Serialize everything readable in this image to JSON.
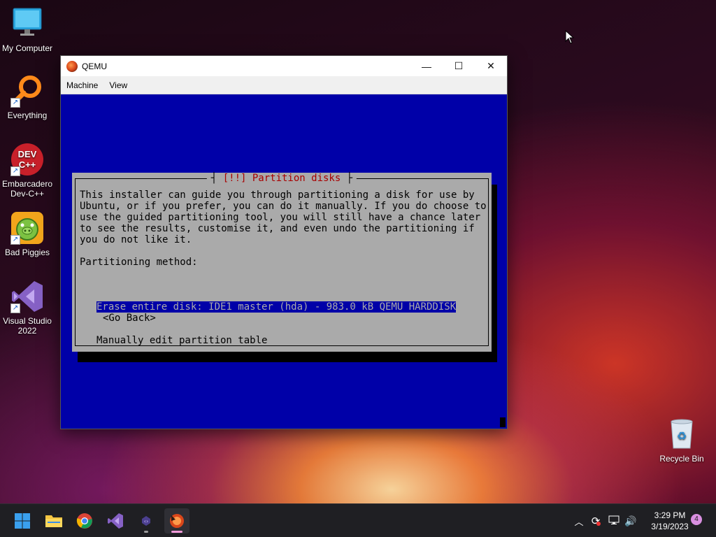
{
  "desktop": {
    "icons": [
      {
        "label": "My Computer",
        "icon": "monitor-icon"
      },
      {
        "label": "Everything",
        "icon": "magnifier-icon"
      },
      {
        "label": "Embarcadero Dev-C++",
        "icon": "devcpp-icon",
        "badge": "DEV C++"
      },
      {
        "label": "Bad Piggies",
        "icon": "pig-icon"
      },
      {
        "label": "Visual Studio 2022",
        "icon": "visual-studio-icon"
      },
      {
        "label": "Recycle Bin",
        "icon": "recycle-bin-icon"
      }
    ]
  },
  "window": {
    "title": "QEMU",
    "menu": [
      "Machine",
      "View"
    ],
    "controls": {
      "minimize": "—",
      "maximize": "☐",
      "close": "✕"
    }
  },
  "installer": {
    "dialog_title": "[!!] Partition disks",
    "body": "This installer can guide you through partitioning a disk for use by\nUbuntu, or if you prefer, you can do it manually. If you do choose to\nuse the guided partitioning tool, you will still have a chance later\nto see the results, customise it, and even undo the partitioning if\nyou do not like it.\n\nPartitioning method:",
    "options": [
      "Erase entire disk: IDE1 master (hda) - 983.0 kB QEMU HARDDISK",
      "Manually edit partition table"
    ],
    "selected_index": 0,
    "go_back": "<Go Back>"
  },
  "taskbar": {
    "apps": [
      "start-icon",
      "file-explorer-icon",
      "chrome-icon",
      "visual-studio-icon",
      "dev-tools-icon",
      "qemu-icon"
    ],
    "clock_time": "3:29 PM",
    "clock_date": "3/19/2023",
    "notification_count": "4"
  },
  "colors": {
    "qemu_blue": "#0000a8",
    "dialog_gray": "#aaaaaa",
    "dialog_title_red": "#a80000",
    "taskbar": "#1f1f23"
  }
}
